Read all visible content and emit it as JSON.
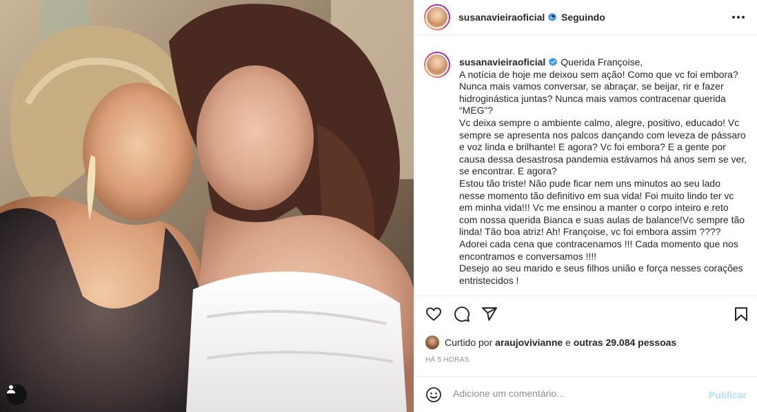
{
  "post": {
    "photo_alt": "Duas mulheres encostando as testas e sorrindo"
  },
  "header": {
    "username": "susanavieiraoficial",
    "separator": "•",
    "follow_label": "Seguindo"
  },
  "caption": {
    "username": "susanavieiraoficial",
    "text": "Querida Françoise,\nA notícia de hoje me deixou sem ação! Como que vc foi embora? Nunca mais vamos conversar, se abraçar, se beijar, rir e fazer hidroginástica juntas? Nunca mais vamos contracenar querida “MEG”?\nVc deixa sempre o ambiente calmo, alegre, positivo, educado! Vc sempre se apresenta nos palcos dançando com leveza de pássaro e voz linda e brilhante! E agora? Vc foi embora? E a gente por causa dessa desastrosa pandemia estávamos há anos sem se ver, se encontrar. E agora?\nEstou tão triste! Não pude ficar nem uns minutos ao seu lado nesse momento tão definitivo em sua vida! Foi muito lindo ter vc em minha vida!!! Vc me ensinou a manter o corpo inteiro e reto com nossa querida Bianca e suas aulas de balance!Vc sempre tão linda! Tão boa atriz! Ah! Françoise, vc foi embora assim ????\nAdorei cada cena que contracenamos !!! Cada momento que nos encontramos e conversamos !!!!\nDesejo ao seu marido e seus filhos união e força nesses corações entristecidos !"
  },
  "likes": {
    "prefix": "Curtido por",
    "user": "araujovivianne",
    "middle": "e",
    "others": "outras 29.084 pessoas"
  },
  "timestamp": "Há 5 horas",
  "comment": {
    "placeholder": "Adicione um comentário...",
    "publish_label": "Publicar"
  },
  "icons": [
    "user-tag-icon",
    "more-options-icon",
    "verified-icon",
    "heart-icon",
    "comment-icon",
    "share-icon",
    "bookmark-icon",
    "emoji-icon"
  ],
  "colors": {
    "verified": "#3897f0",
    "publish_disabled": "#b2dffc",
    "muted": "#8e8e8e",
    "text": "#262626"
  }
}
